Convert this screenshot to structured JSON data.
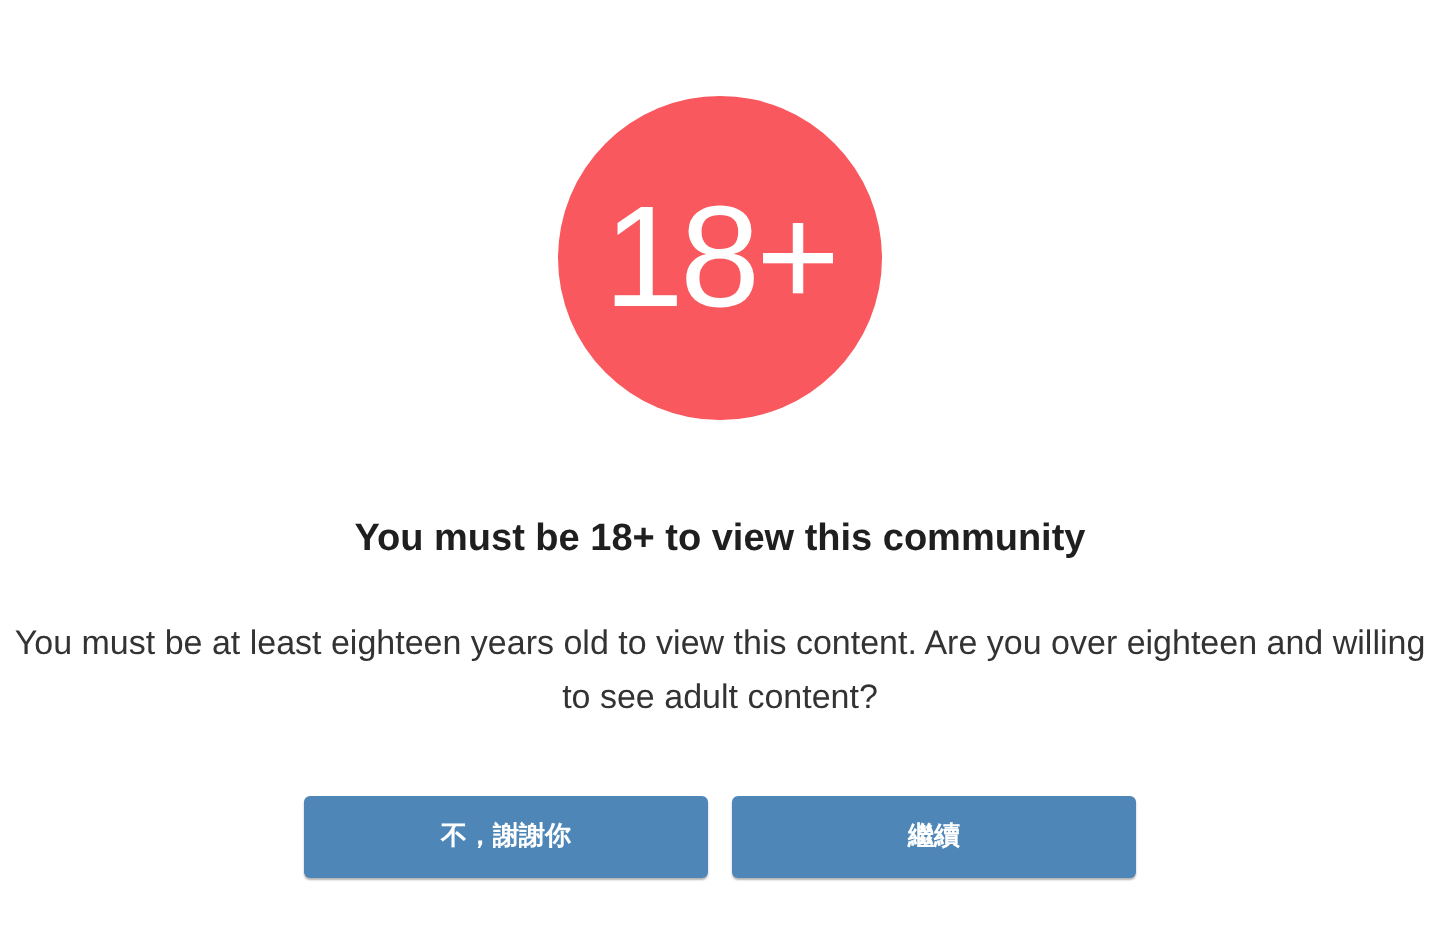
{
  "badge": "18+",
  "title": "You must be 18+ to view this community",
  "message": "You must be at least eighteen years old to view this content. Are you over eighteen and willing to see adult content?",
  "buttons": [
    {
      "label": "不，謝謝你"
    },
    {
      "label": "繼續"
    }
  ]
}
